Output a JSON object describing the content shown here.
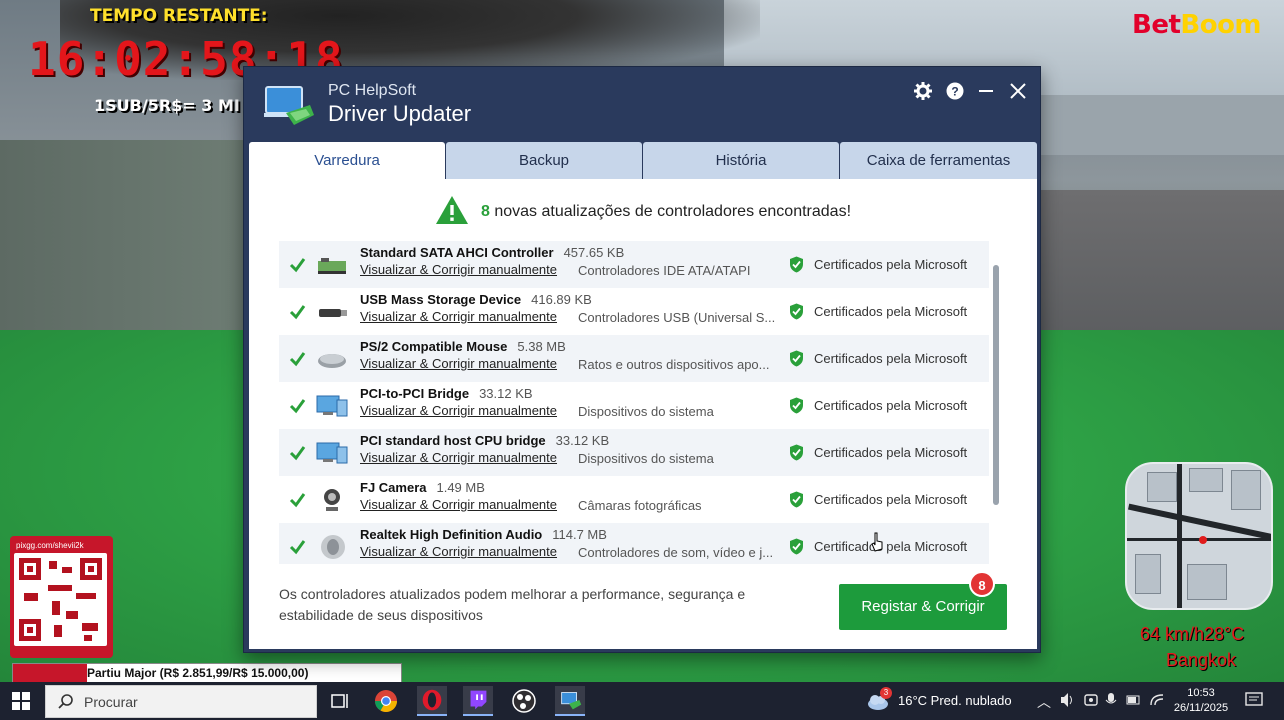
{
  "stream_overlay": {
    "timer_label": "TEMPO RESTANTE:",
    "timer_value": "16:02:58:18",
    "sub_text": "1SUB/5R$= 3 MI",
    "brand_part1": "Bet",
    "brand_part2": "Boom",
    "qr_url": "pixgg.com/shevii2k",
    "donation_text": "Partiu Major (R$ 2.851,99/R$ 15.000,00)",
    "donation_progress": 0.19,
    "speed_text": "64 km/h28°C",
    "city": "Bangkok"
  },
  "window": {
    "company": "PC HelpSoft",
    "product": "Driver Updater",
    "tabs": [
      {
        "label": "Varredura",
        "active": true
      },
      {
        "label": "Backup",
        "active": false
      },
      {
        "label": "História",
        "active": false
      },
      {
        "label": "Caixa de ferramentas",
        "active": false
      }
    ],
    "headline_count": "8",
    "headline_text": "novas atualizações de controladores encontradas!",
    "link_label": "Visualizar & Corrigir manualmente",
    "cert_label": "Certificados pela Microsoft",
    "drivers": [
      {
        "name": "Standard SATA AHCI Controller",
        "size": "457.65 KB",
        "category": "Controladores IDE ATA/ATAPI",
        "icon": "sata-controller-icon"
      },
      {
        "name": "USB Mass Storage Device",
        "size": "416.89 KB",
        "category": "Controladores USB (Universal S...",
        "icon": "usb-drive-icon"
      },
      {
        "name": "PS/2 Compatible Mouse",
        "size": "5.38 MB",
        "category": "Ratos e outros dispositivos apo...",
        "icon": "mouse-icon"
      },
      {
        "name": "PCI-to-PCI Bridge",
        "size": "33.12 KB",
        "category": "Dispositivos do sistema",
        "icon": "monitor-icon"
      },
      {
        "name": "PCI standard host CPU bridge",
        "size": "33.12 KB",
        "category": "Dispositivos do sistema",
        "icon": "monitor-icon"
      },
      {
        "name": "FJ Camera",
        "size": "1.49 MB",
        "category": "Câmaras fotográficas",
        "icon": "webcam-icon"
      },
      {
        "name": "Realtek High Definition Audio",
        "size": "114.7 MB",
        "category": "Controladores de som, vídeo e j...",
        "icon": "speaker-icon"
      }
    ],
    "footer_text": "Os controladores atualizados podem melhorar a performance, segurança e estabilidade de seus dispositivos",
    "fix_button": "Registar & Corrigir",
    "fix_badge": "8",
    "colors": {
      "accent_green": "#1d9b3c",
      "title_bg": "#2a3a5d",
      "badge_red": "#e23434"
    }
  },
  "taskbar": {
    "search_placeholder": "Procurar",
    "weather_badge": "3",
    "weather": "16°C  Pred. nublado",
    "time": "10:53",
    "date": "26/11/2025"
  }
}
